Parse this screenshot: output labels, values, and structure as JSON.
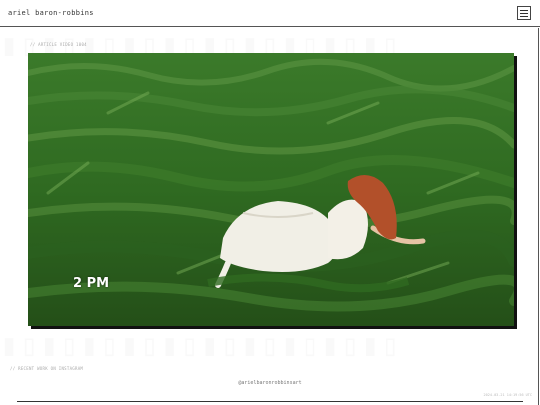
{
  "header": {
    "site_title": "ariel baron-robbins",
    "menu_icon": "hamburger-menu-icon"
  },
  "sections": {
    "video_label": "// ARTICLE VIDEO 1004",
    "instagram_label": "// RECENT WORK ON INSTAGRAM"
  },
  "video": {
    "time_text": "2 PM"
  },
  "instagram": {
    "handle": "@arielbaronrobbinsart",
    "timestamp": "2024-03-21 14:19:56 UTC"
  },
  "colors": {
    "grass_dark": "#2a5e1d",
    "grass_mid": "#3f7d2c",
    "grass_light": "#6fa04f",
    "dress": "#f1efe6",
    "hair": "#b2502a"
  }
}
